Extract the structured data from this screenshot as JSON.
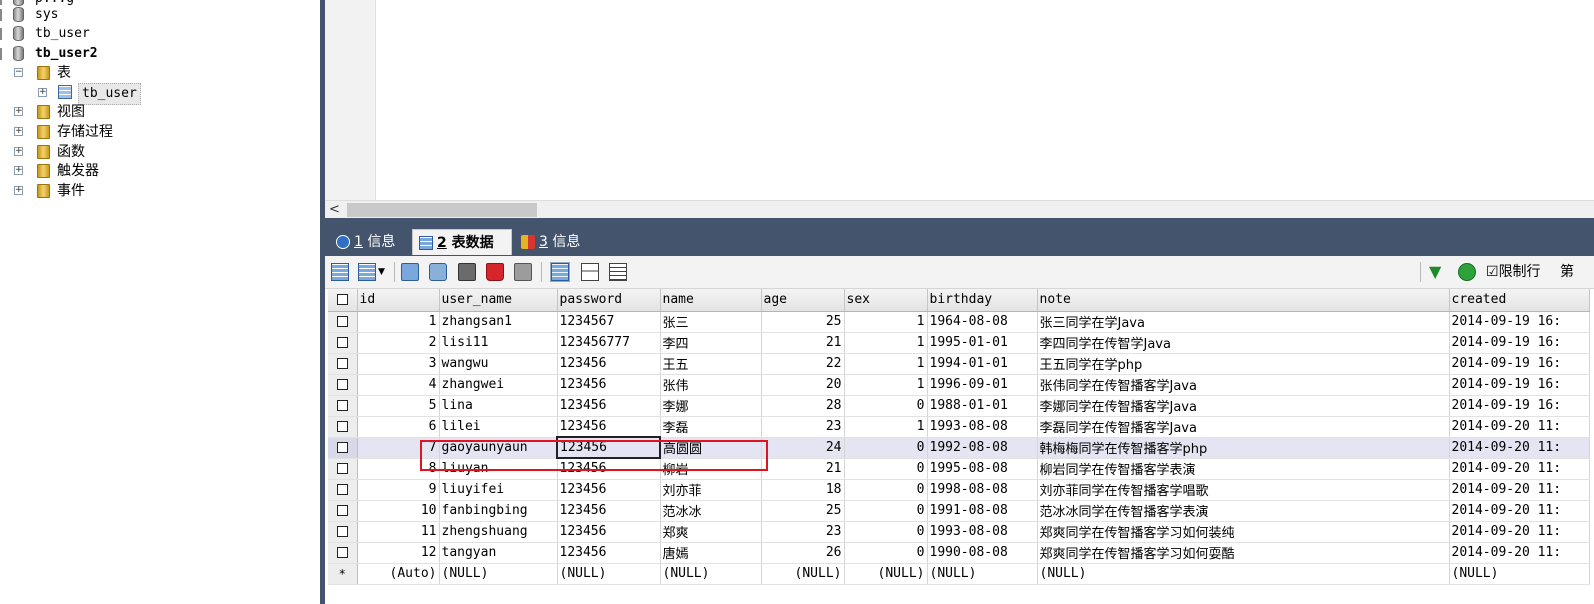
{
  "tree": {
    "top_partial": "p...g",
    "databases": [
      "sys",
      "tb_user",
      "tb_user2"
    ],
    "tables_folder": "表",
    "table_item": "tb_user",
    "folders": [
      "视图",
      "存储过程",
      "函数",
      "触发器",
      "事件"
    ]
  },
  "tabs": [
    {
      "num": "1",
      "label": " 信息"
    },
    {
      "num": "2",
      "label": " 表数据"
    },
    {
      "num": "3",
      "label": " 信息"
    }
  ],
  "toolbar": {
    "limit_label": "限制行",
    "trailing_partial": "第"
  },
  "grid": {
    "columns": [
      "id",
      "user_name",
      "password",
      "name",
      "age",
      "sex",
      "birthday",
      "note",
      "created"
    ],
    "rows": [
      [
        "1",
        "zhangsan1",
        "1234567",
        "张三",
        "25",
        "1",
        "1964-08-08",
        "张三同学在学Java",
        "2014-09-19 16:"
      ],
      [
        "2",
        "lisi11",
        "123456777",
        "李四",
        "21",
        "1",
        "1995-01-01",
        "李四同学在传智学Java",
        "2014-09-19 16:"
      ],
      [
        "3",
        "wangwu",
        "123456",
        "王五",
        "22",
        "1",
        "1994-01-01",
        "王五同学在学php",
        "2014-09-19 16:"
      ],
      [
        "4",
        "zhangwei",
        "123456",
        "张伟",
        "20",
        "1",
        "1996-09-01",
        "张伟同学在传智播客学Java",
        "2014-09-19 16:"
      ],
      [
        "5",
        "lina",
        "123456",
        "李娜",
        "28",
        "0",
        "1988-01-01",
        "李娜同学在传智播客学Java",
        "2014-09-19 16:"
      ],
      [
        "6",
        "lilei",
        "123456",
        "李磊",
        "23",
        "1",
        "1993-08-08",
        "李磊同学在传智播客学Java",
        "2014-09-20 11:"
      ],
      [
        "7",
        "gaoyaunyaun",
        "123456",
        "高圆圆",
        "24",
        "0",
        "1992-08-08",
        "韩梅梅同学在传智播客学php",
        "2014-09-20 11:"
      ],
      [
        "8",
        "liuyan",
        "123456",
        "柳岩",
        "21",
        "0",
        "1995-08-08",
        "柳岩同学在传智播客学表演",
        "2014-09-20 11:"
      ],
      [
        "9",
        "liuyifei",
        "123456",
        "刘亦菲",
        "18",
        "0",
        "1998-08-08",
        "刘亦菲同学在传智播客学唱歌",
        "2014-09-20 11:"
      ],
      [
        "10",
        "fanbingbing",
        "123456",
        "范冰冰",
        "25",
        "0",
        "1991-08-08",
        "范冰冰同学在传智播客学表演",
        "2014-09-20 11:"
      ],
      [
        "11",
        "zhengshuang",
        "123456",
        "郑爽",
        "23",
        "0",
        "1993-08-08",
        "郑爽同学在传智播客学习如何装纯",
        "2014-09-20 11:"
      ],
      [
        "12",
        "tangyan",
        "123456",
        "唐嫣",
        "26",
        "0",
        "1990-08-08",
        "郑爽同学在传智播客学习如何耍酷",
        "2014-09-20 11:"
      ]
    ],
    "new_row": [
      "(Auto)",
      "(NULL)",
      "(NULL)",
      "(NULL)",
      "(NULL)",
      "(NULL)",
      "(NULL)",
      "(NULL)",
      "(NULL)"
    ],
    "new_row_marker": "*"
  },
  "colors": {
    "panel_bg": "#44546c",
    "highlight_box": "#e0141e",
    "current_row": "#e4e4f2"
  },
  "icons": [
    "database-icon",
    "folder-icon",
    "table-icon",
    "info-icon",
    "filter-icon",
    "refresh-icon"
  ]
}
